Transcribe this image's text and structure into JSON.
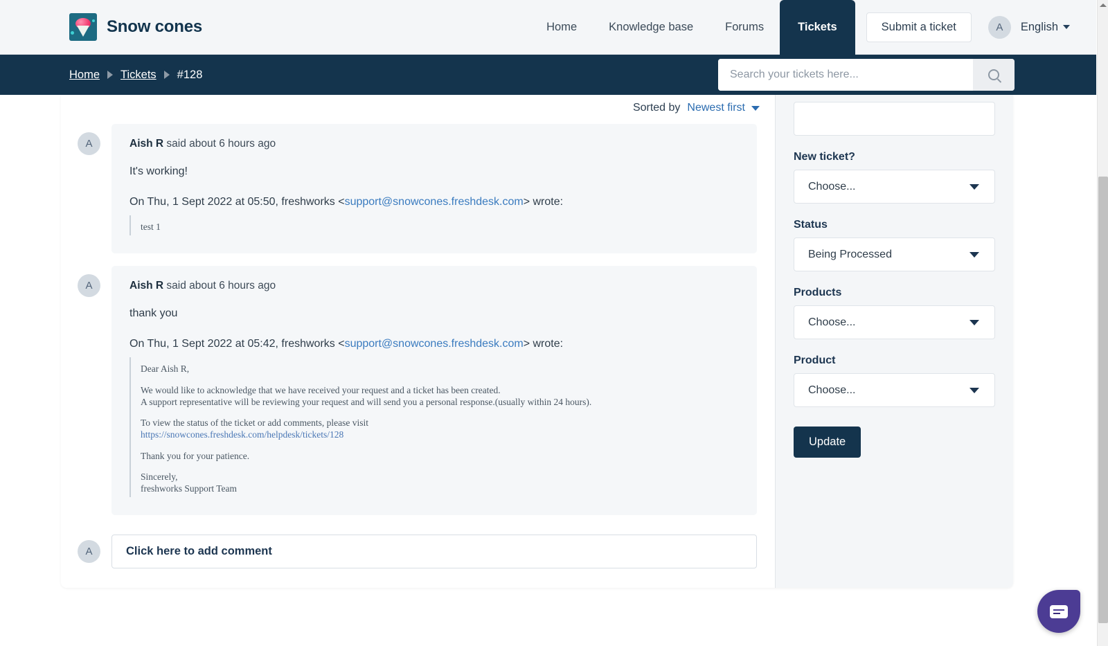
{
  "header": {
    "brand_title": "Snow cones",
    "logo_icon": "snow-cone-logo",
    "nav": [
      {
        "label": "Home",
        "active": false
      },
      {
        "label": "Knowledge base",
        "active": false
      },
      {
        "label": "Forums",
        "active": false
      },
      {
        "label": "Tickets",
        "active": true
      }
    ],
    "submit_ticket_label": "Submit a ticket",
    "avatar_initial": "A",
    "language": "English",
    "language_caret_icon": "caret-down-icon"
  },
  "breadcrumb": {
    "home": "Home",
    "tickets": "Tickets",
    "current": "#128",
    "separator_icon": "triangle-right-icon"
  },
  "search": {
    "placeholder": "Search your tickets here...",
    "value": "",
    "button_icon": "search-icon"
  },
  "sort": {
    "label": "Sorted by",
    "value": "Newest first",
    "caret_icon": "caret-down-icon"
  },
  "comments": [
    {
      "avatar": "A",
      "author": "Aish R",
      "meta_suffix": " said about 6 hours ago",
      "body": "It's working!",
      "quote_intro_prefix": "On Thu, 1 Sept 2022 at 05:50, freshworks <",
      "quote_email": "support@snowcones.freshdesk.com",
      "quote_intro_suffix": "> wrote:",
      "quote_lines": [
        "test 1"
      ]
    },
    {
      "avatar": "A",
      "author": "Aish R",
      "meta_suffix": " said about 6 hours ago",
      "body": "thank you",
      "quote_intro_prefix": "On Thu, 1 Sept 2022 at 05:42, freshworks <",
      "quote_email": "support@snowcones.freshdesk.com",
      "quote_intro_suffix": "> wrote:",
      "quote_lines": [
        "Dear Aish R,",
        "We would like to acknowledge that we have received your request and a ticket has been created.",
        "A support representative will be reviewing your request and will send you a personal response.(usually within 24 hours).",
        "To view the status of the ticket or add comments, please visit",
        "https://snowcones.freshdesk.com/helpdesk/tickets/128",
        "Thank you for your patience.",
        "Sincerely,",
        "freshworks Support Team"
      ]
    }
  ],
  "add_comment": {
    "avatar": "A",
    "placeholder_label": "Click here to add comment"
  },
  "sidebar": {
    "fields": [
      {
        "label": "New ticket?",
        "value": "Choose...",
        "caret_icon": "caret-down-icon"
      },
      {
        "label": "Status",
        "value": "Being Processed",
        "caret_icon": "caret-down-icon"
      },
      {
        "label": "Products",
        "value": "Choose...",
        "caret_icon": "caret-down-icon"
      },
      {
        "label": "Product",
        "value": "Choose...",
        "caret_icon": "caret-down-icon"
      }
    ],
    "update_label": "Update"
  },
  "chat": {
    "icon": "chat-bubble-icon"
  },
  "colors": {
    "navy": "#14344d",
    "page_bg": "#f4f6f8",
    "bubble_bg": "#f5f7f9",
    "link_blue": "#3a7bbf",
    "chat_purple": "#4c3c94"
  }
}
